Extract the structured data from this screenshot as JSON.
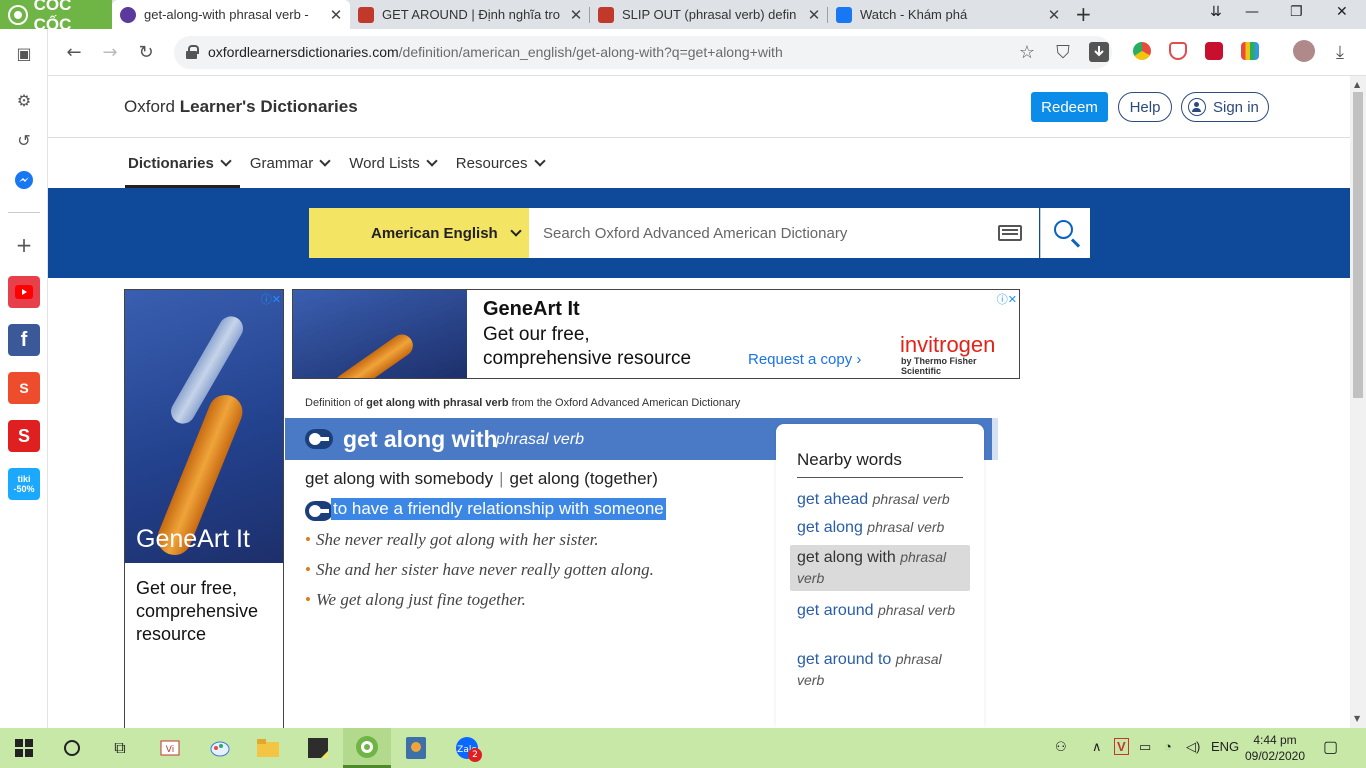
{
  "browser": {
    "brand": "CỐC CỐC",
    "tabs": [
      {
        "title": "get-along-with phrasal verb - ",
        "favicon_color": "#5b3a9e"
      },
      {
        "title": "GET AROUND | Định nghĩa tro",
        "favicon_color": "#c0392b"
      },
      {
        "title": "SLIP OUT (phrasal verb) defin",
        "favicon_color": "#c0392b"
      },
      {
        "title": "Watch - Khám phá",
        "favicon_color": "#1877f2"
      }
    ],
    "new_tab": "+",
    "controls": {
      "tabsearch": "⇊",
      "minimize": "—",
      "restore": "❐",
      "close": "✕"
    },
    "url_host": "oxfordlearnersdictionaries.com",
    "url_path": "/definition/american_english/get-along-with?q=get+along+with",
    "sidebar": {
      "apps": [
        {
          "name": "youtube",
          "color": "#e8404b",
          "glyph": "▶"
        },
        {
          "name": "facebook",
          "color": "#3b5998",
          "glyph": "f"
        },
        {
          "name": "shopee",
          "color": "#ee4d2d",
          "glyph": "S"
        },
        {
          "name": "sendo",
          "color": "#e02020",
          "glyph": "s"
        },
        {
          "name": "tiki",
          "color": "#1ba8ff",
          "glyph": "tiki"
        }
      ],
      "tiki_badge": "-50%"
    }
  },
  "site": {
    "title_plain": "Oxford ",
    "title_bold": "Learner's Dictionaries",
    "redeem": "Redeem",
    "help": "Help",
    "sign_in": "Sign in",
    "nav": [
      "Dictionaries",
      "Grammar",
      "Word Lists",
      "Resources"
    ],
    "dictionary_select": "American English",
    "search_placeholder": "Search Oxford Advanced American Dictionary",
    "brand_yellow": "#f4e464",
    "band_blue": "#0e4a99"
  },
  "ads": {
    "left": {
      "title": "GeneArt It",
      "body": "Get our free, comprehensive resource"
    },
    "top": {
      "title": "GeneArt It",
      "body": "Get our free, comprehensive resource",
      "cta": "Request a copy ›",
      "brand": "invitrogen",
      "brand_sub": "by Thermo Fisher Scientific"
    },
    "choice": "ⓘ✕"
  },
  "entry": {
    "source_prefix": "Definition of ",
    "source_word": "get along with phrasal verb",
    "source_suffix": " from the Oxford Advanced American Dictionary",
    "headword": "get along with",
    "pos": "phrasal verb",
    "pattern_a": "get along with somebody",
    "pattern_sep": "|",
    "pattern_b": "get along (together)",
    "definition": "to have a friendly relationship with someone",
    "examples": [
      "She never really got along with her sister.",
      "She and her sister have never really gotten along.",
      "We get along just fine together."
    ]
  },
  "nearby": {
    "heading": "Nearby words",
    "items": [
      {
        "word": "get ahead",
        "pos": "phrasal verb"
      },
      {
        "word": "get along",
        "pos": "phrasal verb"
      },
      {
        "word": "get along with",
        "pos": "phrasal verb",
        "current": true
      },
      {
        "word": "get around",
        "pos": "phrasal verb"
      },
      {
        "word": "get around to",
        "pos": "phrasal verb"
      }
    ]
  },
  "taskbar": {
    "lang": "ENG",
    "time": "4:44 pm",
    "date": "09/02/2020",
    "zalo_badge": "2"
  }
}
